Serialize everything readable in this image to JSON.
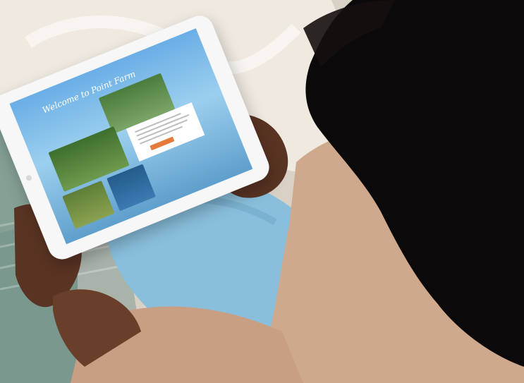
{
  "scene": {
    "type": "photo",
    "colors": {
      "sweater": "#cfa98d",
      "jeans": "#89bfdc",
      "hair": "#0b0909",
      "skin": "#5a3423",
      "blanket": "#efe9e0",
      "rug_teal": "#3f7a6d",
      "cta_orange": "#e47b3a"
    }
  },
  "tablet": {
    "title": "Welcome to Point Farm"
  }
}
